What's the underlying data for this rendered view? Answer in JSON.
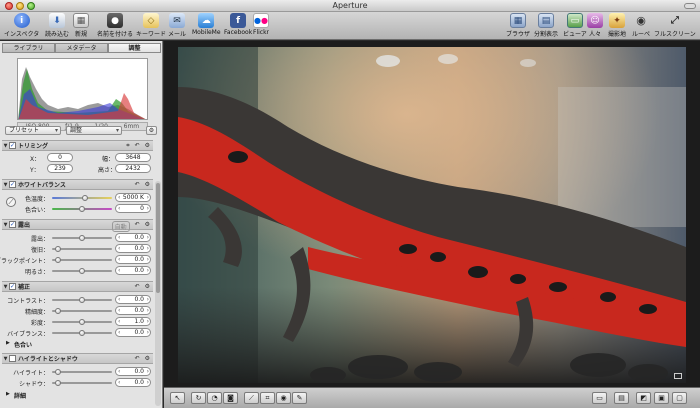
{
  "window": {
    "title": "Aperture"
  },
  "toolbar": {
    "inspector": "インスペクタ",
    "import": "読み込む",
    "new": "新規",
    "name": "名前を付ける",
    "keyword": "キーワード",
    "mail": "メール",
    "mobileme": "MobileMe",
    "facebook": "Facebook",
    "flickr": "Flickr",
    "browser": "ブラウザ",
    "split": "分割表示",
    "viewer": "ビューア",
    "faces": "人々",
    "places": "撮影地",
    "loupe": "ルーペ",
    "fullscreen": "フルスクリーン"
  },
  "tabs": [
    "ライブラリ",
    "メタデータ",
    "調整"
  ],
  "histogram_info": {
    "iso": "ISO 800",
    "aperture": "ƒ/1.9",
    "shutter": "1/20",
    "focal": "6mm"
  },
  "presets": {
    "preset_label": "プリセット",
    "adjust_label": "調整"
  },
  "crop": {
    "title": "トリミング",
    "x_label": "X：",
    "x_value": "0",
    "y_label": "Y：",
    "y_value": "239",
    "w_label": "幅：",
    "w_value": "3648",
    "h_label": "高さ：",
    "h_value": "2432"
  },
  "white_balance": {
    "title": "ホワイトバランス",
    "temp_label": "色温度：",
    "temp_value": "5000 K",
    "temp_level": 0.55,
    "tint_label": "色合い：",
    "tint_value": "0",
    "tint_level": 0.5
  },
  "exposure": {
    "title": "露出",
    "auto_label": "自動",
    "rows": [
      {
        "label": "露出：",
        "value": "0.0",
        "level": 0.5
      },
      {
        "label": "復旧：",
        "value": "0.0",
        "level": 0.05
      },
      {
        "label": "ブラックポイント：",
        "value": "0.0",
        "level": 0.05
      },
      {
        "label": "明るさ：",
        "value": "0.0",
        "level": 0.5
      }
    ]
  },
  "enhance": {
    "title": "補正",
    "rows": [
      {
        "label": "コントラスト：",
        "value": "0.0",
        "level": 0.5
      },
      {
        "label": "精細度：",
        "value": "0.0",
        "level": 0.05
      },
      {
        "label": "彩度：",
        "value": "1.0",
        "level": 0.5
      },
      {
        "label": "バイブランス：",
        "value": "0.0",
        "level": 0.5
      }
    ],
    "tint_label": "色合い"
  },
  "highlights_shadows": {
    "title": "ハイライトとシャドウ",
    "rows": [
      {
        "label": "ハイライト：",
        "value": "0.0",
        "level": 0.05
      },
      {
        "label": "シャドウ：",
        "value": "0.0",
        "level": 0.05
      }
    ],
    "more_label": "詳細"
  },
  "colors": {
    "accent": "#1b4fb8",
    "facebook": "#3b5998",
    "panel": "#e3e3e3"
  },
  "icons": {
    "inspector": "info-icon",
    "import": "import-arrow-icon",
    "new": "new-project-icon",
    "name": "name-person-icon",
    "keyword": "keyword-tag-icon",
    "mail": "mail-icon",
    "mobileme": "cloud-icon",
    "facebook": "facebook-icon",
    "flickr": "flickr-icon"
  }
}
